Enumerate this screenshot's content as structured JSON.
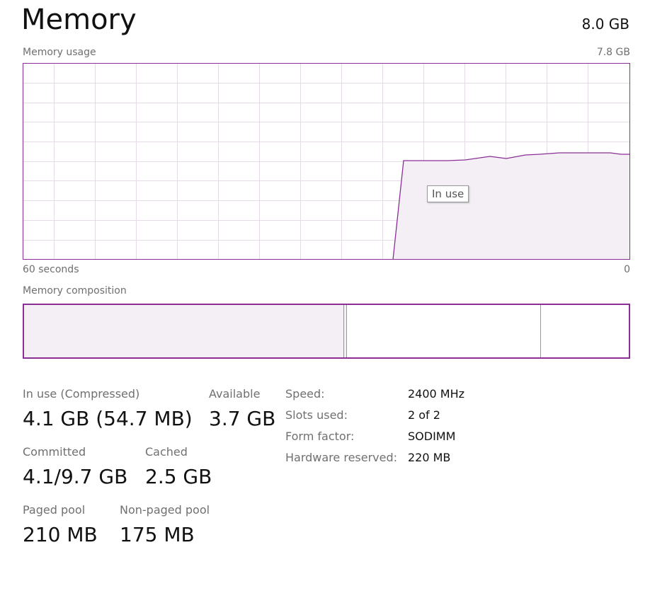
{
  "header": {
    "title": "Memory",
    "total": "8.0 GB"
  },
  "usage_graph": {
    "label": "Memory usage",
    "max_label": "7.8 GB",
    "time_left": "60 seconds",
    "time_right": "0",
    "tooltip": "In use",
    "line_color": "#8b2f97",
    "fill_color": "#f3eff5",
    "grid_color": "#e4dbe7"
  },
  "composition": {
    "label": "Memory composition"
  },
  "stats": {
    "in_use_label": "In use (Compressed)",
    "in_use_value": "4.1 GB (54.7 MB)",
    "available_label": "Available",
    "available_value": "3.7 GB",
    "committed_label": "Committed",
    "committed_value": "4.1/9.7 GB",
    "cached_label": "Cached",
    "cached_value": "2.5 GB",
    "paged_label": "Paged pool",
    "paged_value": "210 MB",
    "nonpaged_label": "Non-paged pool",
    "nonpaged_value": "175 MB"
  },
  "specs": {
    "speed_label": "Speed:",
    "speed_value": "2400 MHz",
    "slots_label": "Slots used:",
    "slots_value": "2 of 2",
    "form_label": "Form factor:",
    "form_value": "SODIMM",
    "reserved_label": "Hardware reserved:",
    "reserved_value": "220 MB"
  }
}
